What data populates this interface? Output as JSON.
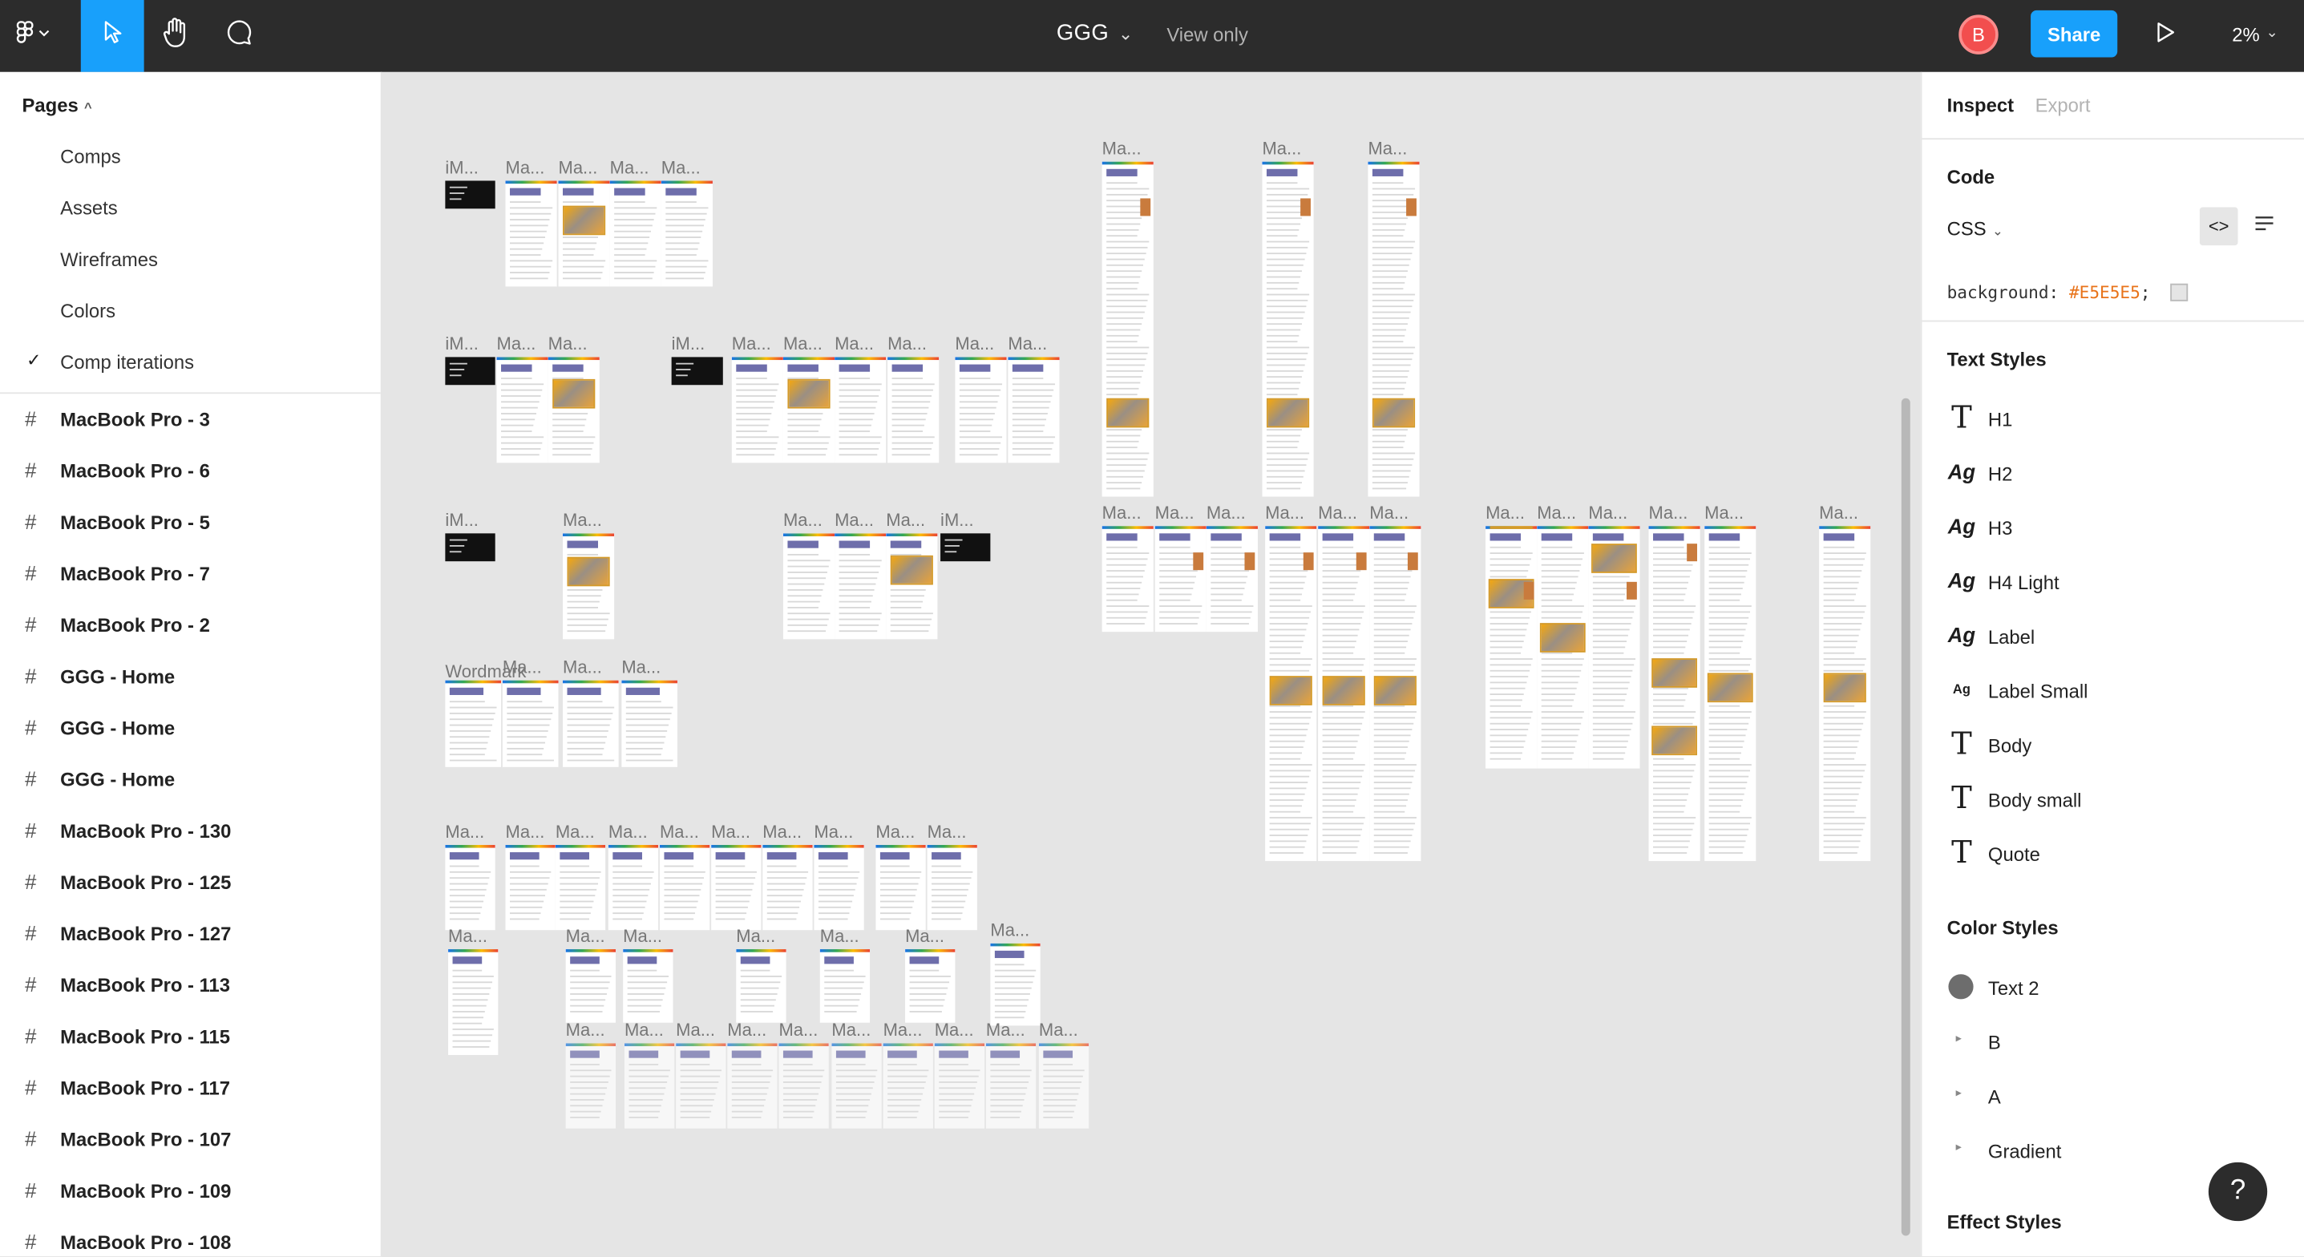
{
  "app": {
    "title": "GGG",
    "mode": "View only",
    "avatar_initial": "B",
    "share_label": "Share",
    "zoom": "2%"
  },
  "colors": {
    "accent": "#18a0fb",
    "topbar": "#2c2c2c",
    "canvas": "#E5E5E5",
    "avatar": "#f24e4e"
  },
  "pages": {
    "header": "Pages",
    "items": [
      "Comps",
      "Assets",
      "Wireframes",
      "Colors",
      "Comp iterations"
    ],
    "selected": "Comp iterations"
  },
  "layers": [
    "MacBook Pro - 3",
    "MacBook Pro - 6",
    "MacBook Pro - 5",
    "MacBook Pro - 7",
    "MacBook Pro - 2",
    "GGG - Home",
    "GGG - Home",
    "GGG - Home",
    "MacBook Pro - 130",
    "MacBook Pro - 125",
    "MacBook Pro - 127",
    "MacBook Pro - 113",
    "MacBook Pro - 115",
    "MacBook Pro - 117",
    "MacBook Pro - 107",
    "MacBook Pro - 109",
    "MacBook Pro - 108"
  ],
  "canvas": {
    "frame_label": "Ma...",
    "frame_label_alt": "iM...",
    "wordmark_label": "Wordmark"
  },
  "inspect": {
    "tab_inspect": "Inspect",
    "tab_export": "Export",
    "code_header": "Code",
    "language": "CSS",
    "css_property": "background:",
    "css_value": "#E5E5E5",
    "css_end": ";",
    "text_styles_header": "Text Styles",
    "text_styles": [
      {
        "name": "H1",
        "icon": "T"
      },
      {
        "name": "H2",
        "icon": "Ag"
      },
      {
        "name": "H3",
        "icon": "Ag"
      },
      {
        "name": "H4 Light",
        "icon": "Ag"
      },
      {
        "name": "Label",
        "icon": "Ag"
      },
      {
        "name": "Label Small",
        "icon": "Ag"
      },
      {
        "name": "Body",
        "icon": "T"
      },
      {
        "name": "Body small",
        "icon": "T"
      },
      {
        "name": "Quote",
        "icon": "T"
      }
    ],
    "color_styles_header": "Color Styles",
    "color_styles": [
      {
        "name": "Text 2",
        "type": "swatch"
      },
      {
        "name": "B",
        "type": "group"
      },
      {
        "name": "A",
        "type": "group"
      },
      {
        "name": "Gradient",
        "type": "group"
      }
    ],
    "effect_styles_header": "Effect Styles"
  },
  "help_label": "?"
}
